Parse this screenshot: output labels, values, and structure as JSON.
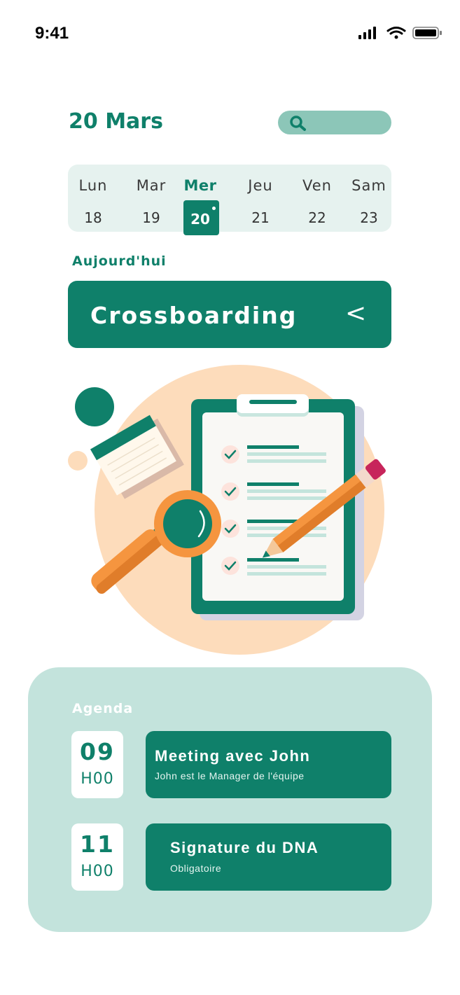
{
  "status": {
    "time": "9:41"
  },
  "header": {
    "date": "20 Mars"
  },
  "week": [
    {
      "name": "Lun",
      "num": "18",
      "active": false
    },
    {
      "name": "Mar",
      "num": "19",
      "active": false
    },
    {
      "name": "Mer",
      "num": "20",
      "active": true
    },
    {
      "name": "Jeu",
      "num": "21",
      "active": false
    },
    {
      "name": "Ven",
      "num": "22",
      "active": false
    },
    {
      "name": "Sam",
      "num": "23",
      "active": false
    }
  ],
  "today_label": "Aujourd'hui",
  "banner": {
    "title": "Crossboarding",
    "chevron": "<"
  },
  "agenda": {
    "title": "Agenda",
    "items": [
      {
        "hour": "09",
        "minutes": "H00",
        "title": "Meeting avec John",
        "subtitle": "John est le Manager de l'équipe"
      },
      {
        "hour": "11",
        "minutes": "H00",
        "title": "Signature du DNA",
        "subtitle": "Obligatoire"
      }
    ]
  },
  "colors": {
    "primary": "#0f806a",
    "search_pill": "#8cc6b8",
    "week_bg": "#e6f2ef",
    "agenda_bg": "#c3e3dc",
    "peach": "#fddcbb",
    "orange": "#f5953f"
  },
  "icons": [
    "cellular-signal-icon",
    "wifi-icon",
    "battery-icon",
    "search-icon",
    "chevron-left-icon"
  ]
}
